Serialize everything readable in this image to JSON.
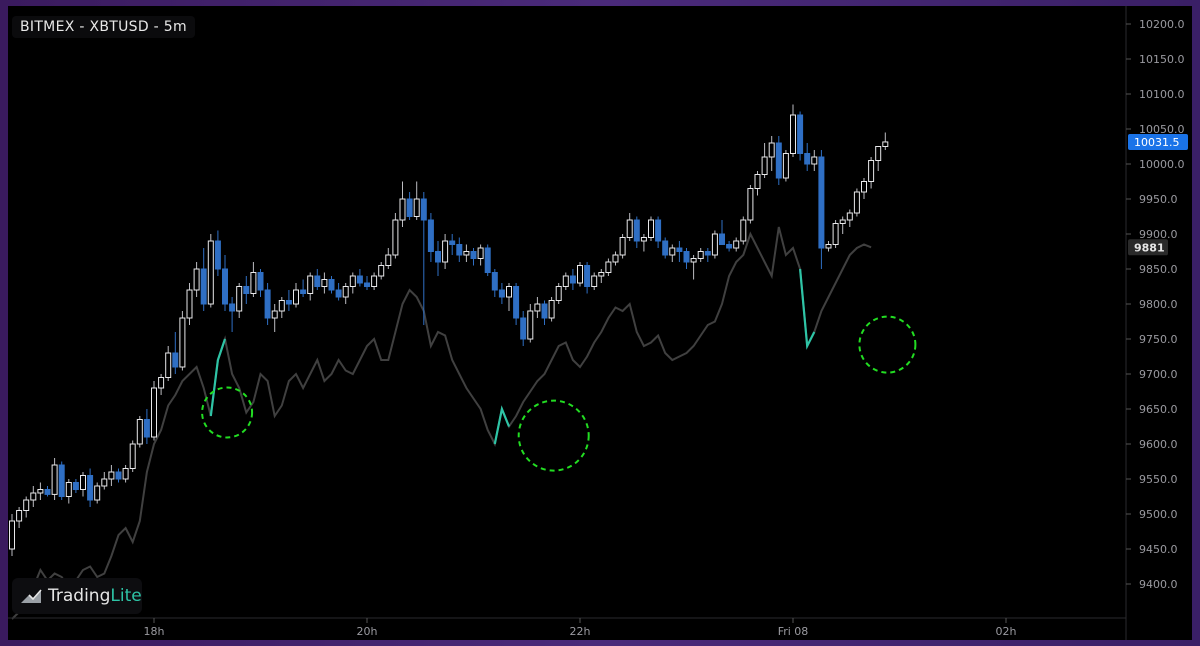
{
  "header": {
    "title": "BITMEX - XBTUSD - 5m"
  },
  "branding": {
    "logo_part1": "Trading",
    "logo_part2": "Lite",
    "icon": "tradinglite-logo-icon"
  },
  "colors": {
    "background": "#000000",
    "up_candle": "#e8e8ea",
    "down_candle": "#2f6fc4",
    "line": "#404040",
    "line_highlight": "#2ec4a6",
    "circle": "#22dd22",
    "price_badge": "#1a73e8",
    "line_badge": "#2a2a2a"
  },
  "chart_data": {
    "type": "candlestick",
    "title": "BITMEX - XBTUSD - 5m",
    "symbol": "XBTUSD",
    "exchange": "BITMEX",
    "timeframe": "5m",
    "xlabel": "",
    "ylabel": "",
    "ylim": [
      9370,
      10235
    ],
    "y_ticks": [
      9400,
      9450,
      9500,
      9550,
      9600,
      9650,
      9700,
      9750,
      9800,
      9850,
      9900,
      9950,
      10000,
      10050,
      10100,
      10150,
      10200
    ],
    "y_tick_labels": [
      "9400.0",
      "9450.0",
      "9500.0",
      "9550.0",
      "9600.0",
      "9650.0",
      "9700.0",
      "9750.0",
      "9800.0",
      "9850.0",
      "9900.0",
      "9950.0",
      "10000.0",
      "10050.0",
      "10100.0",
      "10150.0",
      "10200.0"
    ],
    "x_ticks": [
      {
        "label": "18h",
        "index": 20
      },
      {
        "label": "20h",
        "index": 50
      },
      {
        "label": "22h",
        "index": 80
      },
      {
        "label": "Fri 08",
        "index": 110
      },
      {
        "label": "02h",
        "index": 140
      }
    ],
    "last_price": 10031.5,
    "last_price_label": "10031.5",
    "line_last_value": 9881,
    "line_last_label": "9881",
    "grid": false,
    "candles": [
      [
        9450,
        9500,
        9440,
        9490
      ],
      [
        9490,
        9510,
        9480,
        9505
      ],
      [
        9505,
        9525,
        9495,
        9520
      ],
      [
        9520,
        9540,
        9510,
        9530
      ],
      [
        9530,
        9545,
        9520,
        9535
      ],
      [
        9535,
        9540,
        9525,
        9528
      ],
      [
        9528,
        9580,
        9520,
        9570
      ],
      [
        9570,
        9575,
        9520,
        9525
      ],
      [
        9525,
        9550,
        9515,
        9545
      ],
      [
        9545,
        9550,
        9530,
        9535
      ],
      [
        9535,
        9560,
        9525,
        9555
      ],
      [
        9555,
        9565,
        9510,
        9520
      ],
      [
        9520,
        9545,
        9515,
        9540
      ],
      [
        9540,
        9560,
        9535,
        9550
      ],
      [
        9550,
        9570,
        9540,
        9560
      ],
      [
        9560,
        9565,
        9545,
        9550
      ],
      [
        9550,
        9570,
        9545,
        9565
      ],
      [
        9565,
        9605,
        9560,
        9600
      ],
      [
        9600,
        9640,
        9595,
        9635
      ],
      [
        9635,
        9650,
        9600,
        9610
      ],
      [
        9610,
        9690,
        9605,
        9680
      ],
      [
        9680,
        9700,
        9670,
        9695
      ],
      [
        9695,
        9740,
        9690,
        9730
      ],
      [
        9730,
        9760,
        9700,
        9710
      ],
      [
        9710,
        9790,
        9705,
        9780
      ],
      [
        9780,
        9830,
        9770,
        9820
      ],
      [
        9820,
        9860,
        9810,
        9850
      ],
      [
        9850,
        9880,
        9790,
        9800
      ],
      [
        9800,
        9900,
        9795,
        9890
      ],
      [
        9890,
        9905,
        9840,
        9850
      ],
      [
        9850,
        9870,
        9790,
        9800
      ],
      [
        9800,
        9810,
        9760,
        9790
      ],
      [
        9790,
        9830,
        9780,
        9825
      ],
      [
        9825,
        9840,
        9800,
        9815
      ],
      [
        9815,
        9860,
        9810,
        9845
      ],
      [
        9845,
        9850,
        9810,
        9820
      ],
      [
        9820,
        9830,
        9770,
        9780
      ],
      [
        9780,
        9800,
        9760,
        9790
      ],
      [
        9790,
        9810,
        9780,
        9805
      ],
      [
        9805,
        9820,
        9790,
        9800
      ],
      [
        9800,
        9830,
        9795,
        9820
      ],
      [
        9820,
        9835,
        9810,
        9815
      ],
      [
        9815,
        9845,
        9805,
        9840
      ],
      [
        9840,
        9850,
        9820,
        9825
      ],
      [
        9825,
        9845,
        9815,
        9835
      ],
      [
        9835,
        9840,
        9815,
        9820
      ],
      [
        9820,
        9830,
        9805,
        9810
      ],
      [
        9810,
        9830,
        9800,
        9825
      ],
      [
        9825,
        9845,
        9815,
        9840
      ],
      [
        9840,
        9850,
        9825,
        9830
      ],
      [
        9830,
        9840,
        9820,
        9825
      ],
      [
        9825,
        9845,
        9820,
        9840
      ],
      [
        9840,
        9860,
        9835,
        9855
      ],
      [
        9855,
        9880,
        9850,
        9870
      ],
      [
        9870,
        9930,
        9865,
        9920
      ],
      [
        9920,
        9975,
        9910,
        9950
      ],
      [
        9950,
        9960,
        9920,
        9925
      ],
      [
        9925,
        9975,
        9920,
        9950
      ],
      [
        9950,
        9960,
        9770,
        9920
      ],
      [
        9920,
        9930,
        9860,
        9875
      ],
      [
        9875,
        9890,
        9840,
        9860
      ],
      [
        9860,
        9900,
        9850,
        9890
      ],
      [
        9890,
        9900,
        9870,
        9885
      ],
      [
        9885,
        9895,
        9860,
        9870
      ],
      [
        9870,
        9885,
        9860,
        9875
      ],
      [
        9875,
        9880,
        9855,
        9865
      ],
      [
        9865,
        9885,
        9855,
        9880
      ],
      [
        9880,
        9885,
        9840,
        9845
      ],
      [
        9845,
        9850,
        9810,
        9820
      ],
      [
        9820,
        9830,
        9800,
        9810
      ],
      [
        9810,
        9830,
        9790,
        9825
      ],
      [
        9825,
        9830,
        9770,
        9780
      ],
      [
        9780,
        9790,
        9740,
        9750
      ],
      [
        9750,
        9800,
        9745,
        9790
      ],
      [
        9790,
        9810,
        9780,
        9800
      ],
      [
        9800,
        9805,
        9770,
        9780
      ],
      [
        9780,
        9810,
        9775,
        9805
      ],
      [
        9805,
        9830,
        9800,
        9825
      ],
      [
        9825,
        9845,
        9820,
        9840
      ],
      [
        9840,
        9850,
        9820,
        9830
      ],
      [
        9830,
        9860,
        9825,
        9855
      ],
      [
        9855,
        9860,
        9815,
        9825
      ],
      [
        9825,
        9845,
        9820,
        9840
      ],
      [
        9840,
        9850,
        9830,
        9845
      ],
      [
        9845,
        9865,
        9840,
        9860
      ],
      [
        9860,
        9875,
        9855,
        9870
      ],
      [
        9870,
        9900,
        9865,
        9895
      ],
      [
        9895,
        9930,
        9890,
        9920
      ],
      [
        9920,
        9925,
        9880,
        9890
      ],
      [
        9890,
        9900,
        9875,
        9895
      ],
      [
        9895,
        9925,
        9890,
        9920
      ],
      [
        9920,
        9925,
        9880,
        9890
      ],
      [
        9890,
        9895,
        9865,
        9870
      ],
      [
        9870,
        9885,
        9860,
        9880
      ],
      [
        9880,
        9890,
        9860,
        9875
      ],
      [
        9875,
        9880,
        9850,
        9860
      ],
      [
        9860,
        9870,
        9835,
        9865
      ],
      [
        9865,
        9880,
        9860,
        9875
      ],
      [
        9875,
        9880,
        9860,
        9870
      ],
      [
        9870,
        9905,
        9865,
        9900
      ],
      [
        9900,
        9920,
        9885,
        9885
      ],
      [
        9885,
        9890,
        9875,
        9880
      ],
      [
        9880,
        9895,
        9875,
        9890
      ],
      [
        9890,
        9925,
        9885,
        9920
      ],
      [
        9920,
        9970,
        9915,
        9965
      ],
      [
        9965,
        9990,
        9955,
        9985
      ],
      [
        9985,
        10030,
        9980,
        10010
      ],
      [
        10010,
        10040,
        9990,
        10030
      ],
      [
        10030,
        10040,
        9970,
        9980
      ],
      [
        9980,
        10020,
        9975,
        10015
      ],
      [
        10015,
        10085,
        10010,
        10070
      ],
      [
        10070,
        10075,
        10005,
        10015
      ],
      [
        10015,
        10030,
        9990,
        10000
      ],
      [
        10000,
        10020,
        9990,
        10010
      ],
      [
        10010,
        10020,
        9850,
        9880
      ],
      [
        9880,
        9890,
        9875,
        9885
      ],
      [
        9885,
        9920,
        9880,
        9915
      ],
      [
        9915,
        9925,
        9900,
        9920
      ],
      [
        9920,
        9935,
        9910,
        9930
      ],
      [
        9930,
        9965,
        9925,
        9960
      ],
      [
        9960,
        9980,
        9950,
        9975
      ],
      [
        9975,
        10010,
        9965,
        10005
      ],
      [
        10005,
        10020,
        9990,
        10025
      ],
      [
        10025,
        10045,
        10020,
        10031.5
      ]
    ],
    "series": [
      {
        "values": [
          9350,
          9360,
          9380,
          9395,
          9420,
          9405,
          9415,
          9410,
          9395,
          9405,
          9420,
          9425,
          9410,
          9415,
          9440,
          9470,
          9480,
          9460,
          9490,
          9560,
          9600,
          9620,
          9655,
          9670,
          9690,
          9700,
          9710,
          9680,
          9640,
          9720,
          9750,
          9700,
          9680,
          9645,
          9660,
          9700,
          9690,
          9640,
          9655,
          9690,
          9700,
          9680,
          9700,
          9720,
          9690,
          9700,
          9720,
          9705,
          9700,
          9720,
          9740,
          9750,
          9720,
          9720,
          9760,
          9800,
          9820,
          9810,
          9790,
          9740,
          9760,
          9755,
          9720,
          9700,
          9680,
          9665,
          9650,
          9620,
          9600,
          9650,
          9625,
          9640,
          9660,
          9675,
          9690,
          9700,
          9720,
          9740,
          9745,
          9720,
          9710,
          9725,
          9745,
          9760,
          9780,
          9795,
          9790,
          9800,
          9760,
          9740,
          9745,
          9755,
          9730,
          9720,
          9725,
          9730,
          9740,
          9755,
          9770,
          9775,
          9800,
          9840,
          9860,
          9870,
          9900,
          9880,
          9860,
          9840,
          9910,
          9870,
          9880,
          9850,
          9740,
          9760,
          9790,
          9810,
          9830,
          9850,
          9870,
          9880,
          9885,
          9881
        ]
      }
    ]
  }
}
